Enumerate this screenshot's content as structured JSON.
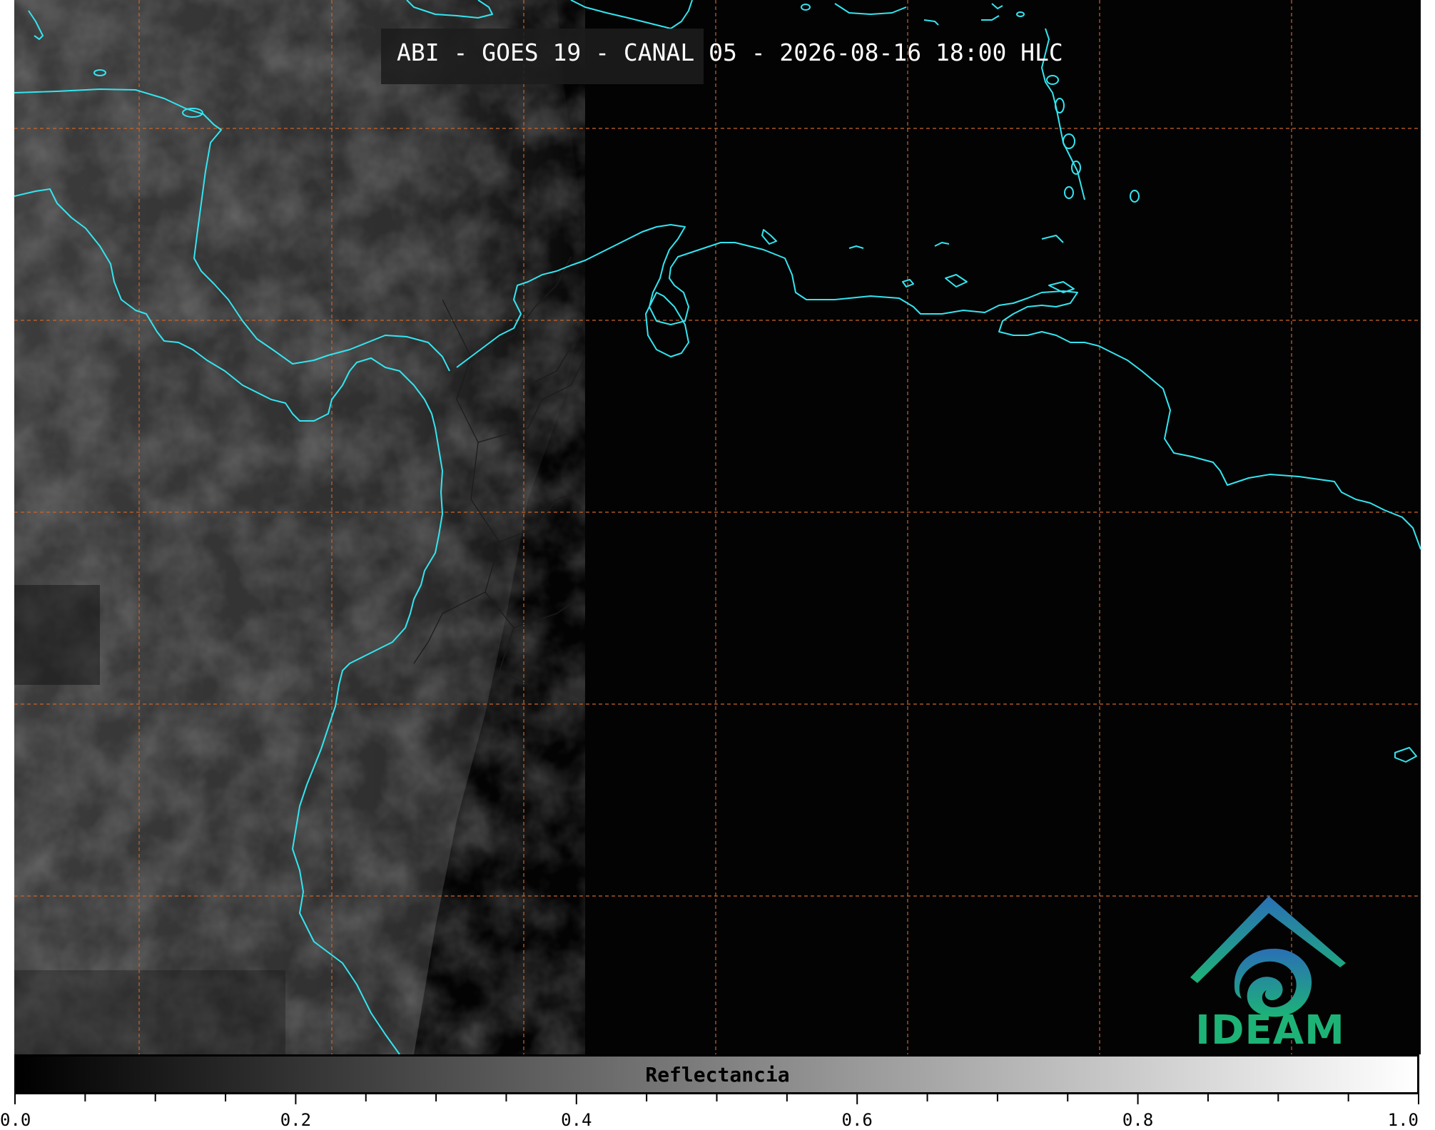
{
  "title": "ABI - GOES 19 - CANAL 05 - 2026-08-16 18:00 HLC",
  "colorbar": {
    "label": "Reflectancia",
    "ticks": [
      "0.0",
      "0.2",
      "0.4",
      "0.6",
      "0.8",
      "1.0"
    ],
    "range": [
      0.0,
      1.0
    ],
    "gradient_from": "#000000",
    "gradient_to": "#ffffff"
  },
  "logo": {
    "text": "IDEAM"
  },
  "colors": {
    "coastline": "#33e5f0",
    "gridline": "#c9642a",
    "borders": "#2a2a2a",
    "logo_blue": "#2a6fb5",
    "logo_green": "#1db377"
  }
}
